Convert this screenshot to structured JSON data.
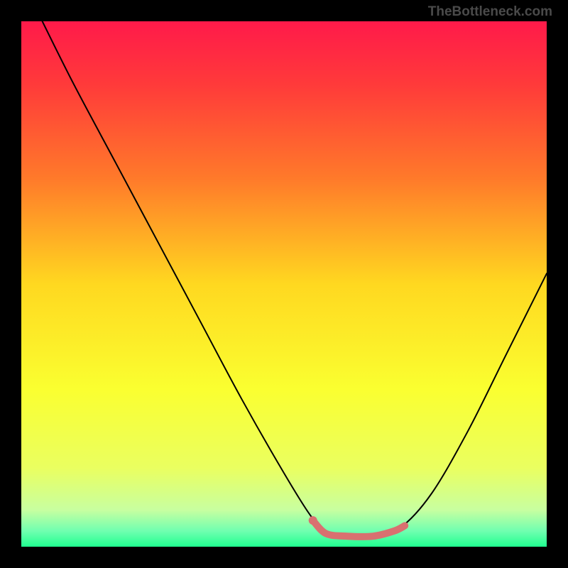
{
  "watermark": "TheBottleneck.com",
  "chart_data": {
    "type": "line",
    "title": "",
    "xlabel": "",
    "ylabel": "",
    "xlim": [
      0,
      100
    ],
    "ylim": [
      0,
      100
    ],
    "background_gradient": {
      "stops": [
        {
          "offset": 0.0,
          "color": "#ff1a4a"
        },
        {
          "offset": 0.12,
          "color": "#ff3a3a"
        },
        {
          "offset": 0.3,
          "color": "#ff7a2a"
        },
        {
          "offset": 0.5,
          "color": "#ffd820"
        },
        {
          "offset": 0.7,
          "color": "#faff30"
        },
        {
          "offset": 0.85,
          "color": "#eaff60"
        },
        {
          "offset": 0.93,
          "color": "#c8ffa0"
        },
        {
          "offset": 0.97,
          "color": "#70ffb0"
        },
        {
          "offset": 1.0,
          "color": "#20ff90"
        }
      ]
    },
    "series": [
      {
        "name": "curve",
        "color": "#000000",
        "width": 2,
        "points": [
          {
            "x": 4,
            "y": 100
          },
          {
            "x": 10,
            "y": 88
          },
          {
            "x": 18,
            "y": 73
          },
          {
            "x": 26,
            "y": 58
          },
          {
            "x": 34,
            "y": 43
          },
          {
            "x": 42,
            "y": 28
          },
          {
            "x": 50,
            "y": 14
          },
          {
            "x": 55,
            "y": 6
          },
          {
            "x": 58,
            "y": 3
          },
          {
            "x": 62,
            "y": 2
          },
          {
            "x": 67,
            "y": 2
          },
          {
            "x": 72,
            "y": 3.5
          },
          {
            "x": 78,
            "y": 10
          },
          {
            "x": 85,
            "y": 22
          },
          {
            "x": 92,
            "y": 36
          },
          {
            "x": 100,
            "y": 52
          }
        ]
      },
      {
        "name": "highlight",
        "color": "#d97070",
        "width": 10,
        "points": [
          {
            "x": 55.5,
            "y": 5.0
          },
          {
            "x": 58,
            "y": 2.5
          },
          {
            "x": 62,
            "y": 2.0
          },
          {
            "x": 67,
            "y": 2.0
          },
          {
            "x": 71,
            "y": 3.0
          },
          {
            "x": 73,
            "y": 4.0
          }
        ],
        "dot": {
          "x": 55.5,
          "y": 5.0,
          "r": 6
        }
      }
    ]
  }
}
